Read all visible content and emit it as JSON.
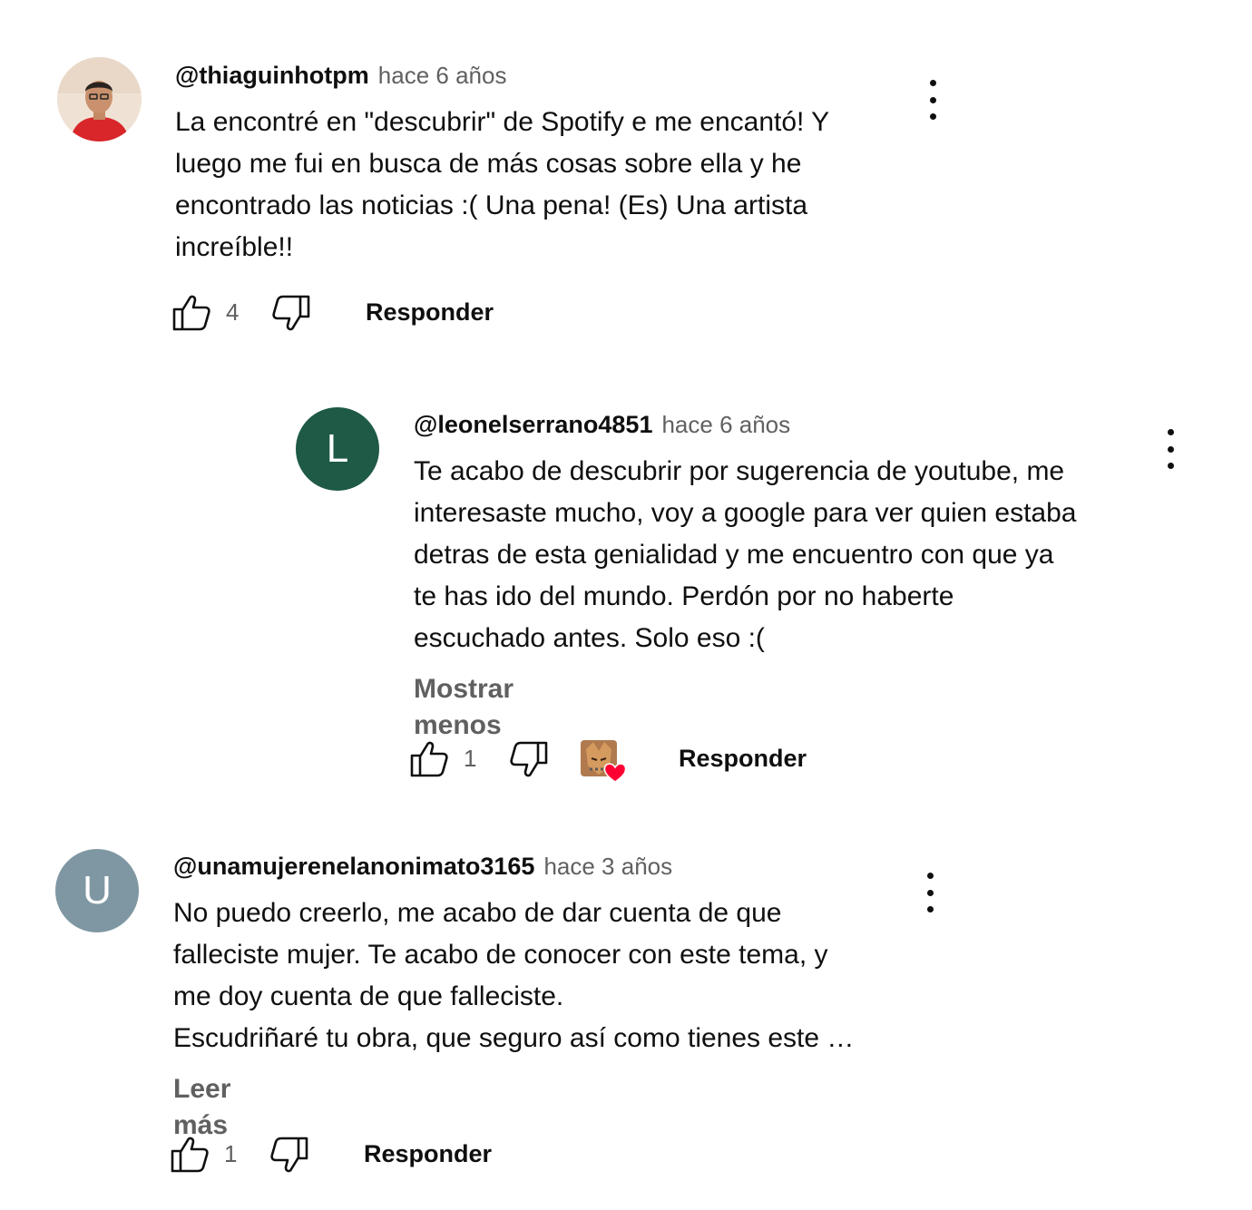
{
  "comments": [
    {
      "author": "@thiaguinhotpm",
      "time": "hace 6 años",
      "avatar": {
        "type": "photo"
      },
      "text": "La encontré en \"descubrir\" de Spotify e me encantó! Y\nluego me fui en busca de más cosas sobre ella y he\nencontrado las noticias :( Una pena! (Es) Una artista\nincreíble!!",
      "likes": "4",
      "reply_label": "Responder"
    },
    {
      "author": "@leonelserrano4851",
      "time": "hace 6 años",
      "avatar": {
        "type": "letter",
        "letter": "L",
        "color": "#1e5a45"
      },
      "text": "Te acabo de descubrir por sugerencia de youtube, me\ninteresaste mucho, voy a google para ver quien estaba\ndetras de esta genialidad y me encuentro con que ya\nte has ido del mundo. Perdón por no haberte\nescuchado antes. Solo eso :(",
      "toggle_label": "Mostrar menos",
      "likes": "1",
      "creator_heart": true,
      "reply_label": "Responder"
    },
    {
      "author": "@unamujerenelanonimato3165",
      "time": "hace 3 años",
      "avatar": {
        "type": "letter",
        "letter": "U",
        "color": "#7f97a3"
      },
      "text": "No puedo creerlo, me acabo de dar cuenta de que\nfalleciste mujer. Te acabo de conocer con este tema, y\nme doy cuenta de que falleciste.\nEscudriñaré tu obra, que seguro así como tienes este …",
      "toggle_label": "Leer más",
      "likes": "1",
      "reply_label": "Responder"
    }
  ],
  "icons": {
    "like": "thumb-up-icon",
    "dislike": "thumb-down-icon",
    "menu": "more-vert-icon",
    "heart": "heart-icon"
  },
  "colors": {
    "heart": "#ff0033",
    "secondary_text": "#606060"
  }
}
